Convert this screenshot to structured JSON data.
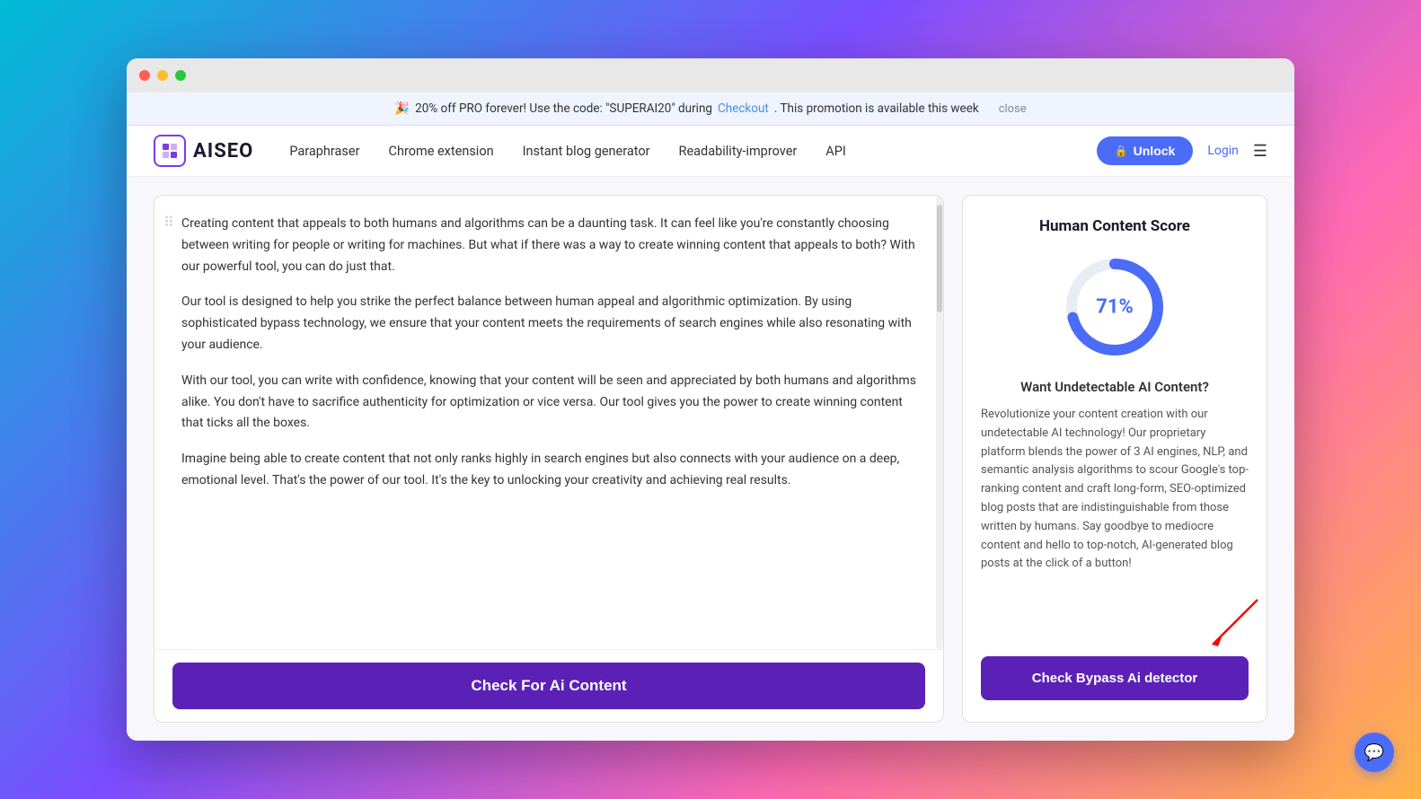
{
  "promo": {
    "emoji": "🎉",
    "text": "20% off PRO forever! Use the code: \"SUPERAI20\" during",
    "checkout_link": "Checkout",
    "text2": ". This promotion is available this week",
    "close_label": "close"
  },
  "navbar": {
    "logo_text": "AISEO",
    "links": [
      {
        "label": "Paraphraser"
      },
      {
        "label": "Chrome extension"
      },
      {
        "label": "Instant blog generator"
      },
      {
        "label": "Readability-improver"
      },
      {
        "label": "API"
      }
    ],
    "unlock_label": "Unlock",
    "login_label": "Login"
  },
  "left_panel": {
    "paragraphs": [
      "Creating content that appeals to both humans and algorithms can be a daunting task. It can feel like you're constantly choosing between writing for people or writing for machines. But what if there was a way to create winning content that appeals to both? With our powerful tool, you can do just that.",
      "Our tool is designed to help you strike the perfect balance between human appeal and algorithmic optimization. By using sophisticated bypass technology, we ensure that your content meets the requirements of search engines while also resonating with your audience.",
      "With our tool, you can write with confidence, knowing that your content will be seen and appreciated by both humans and algorithms alike. You don't have to sacrifice authenticity for optimization or vice versa. Our tool gives you the power to create winning content that ticks all the boxes.",
      "Imagine being able to create content that not only ranks highly in search engines but also connects with your audience on a deep, emotional level. That's the power of our tool. It's the key to unlocking your creativity and achieving real results."
    ],
    "check_btn_label": "Check For Ai Content"
  },
  "right_panel": {
    "title": "Human Content Score",
    "score_percent": "71%",
    "score_value": 71,
    "undetectable_title": "Want Undetectable AI Content?",
    "promo_text": "Revolutionize your content creation with our undetectable AI technology! Our proprietary platform blends the power of 3 AI engines, NLP, and semantic analysis algorithms to scour Google's top-ranking content and craft long-form, SEO-optimized blog posts that are indistinguishable from those written by humans. Say goodbye to mediocre content and hello to top-notch, AI-generated blog posts at the click of a button!",
    "bypass_btn_label": "Check Bypass Ai detector"
  },
  "icons": {
    "lock": "🔒",
    "chat": "💬",
    "drag": "⠿",
    "menu": "☰"
  },
  "colors": {
    "primary": "#5b21b6",
    "blue": "#4a6cf7",
    "donut_bg": "#e8edf5",
    "donut_fill": "#4a6cf7"
  }
}
